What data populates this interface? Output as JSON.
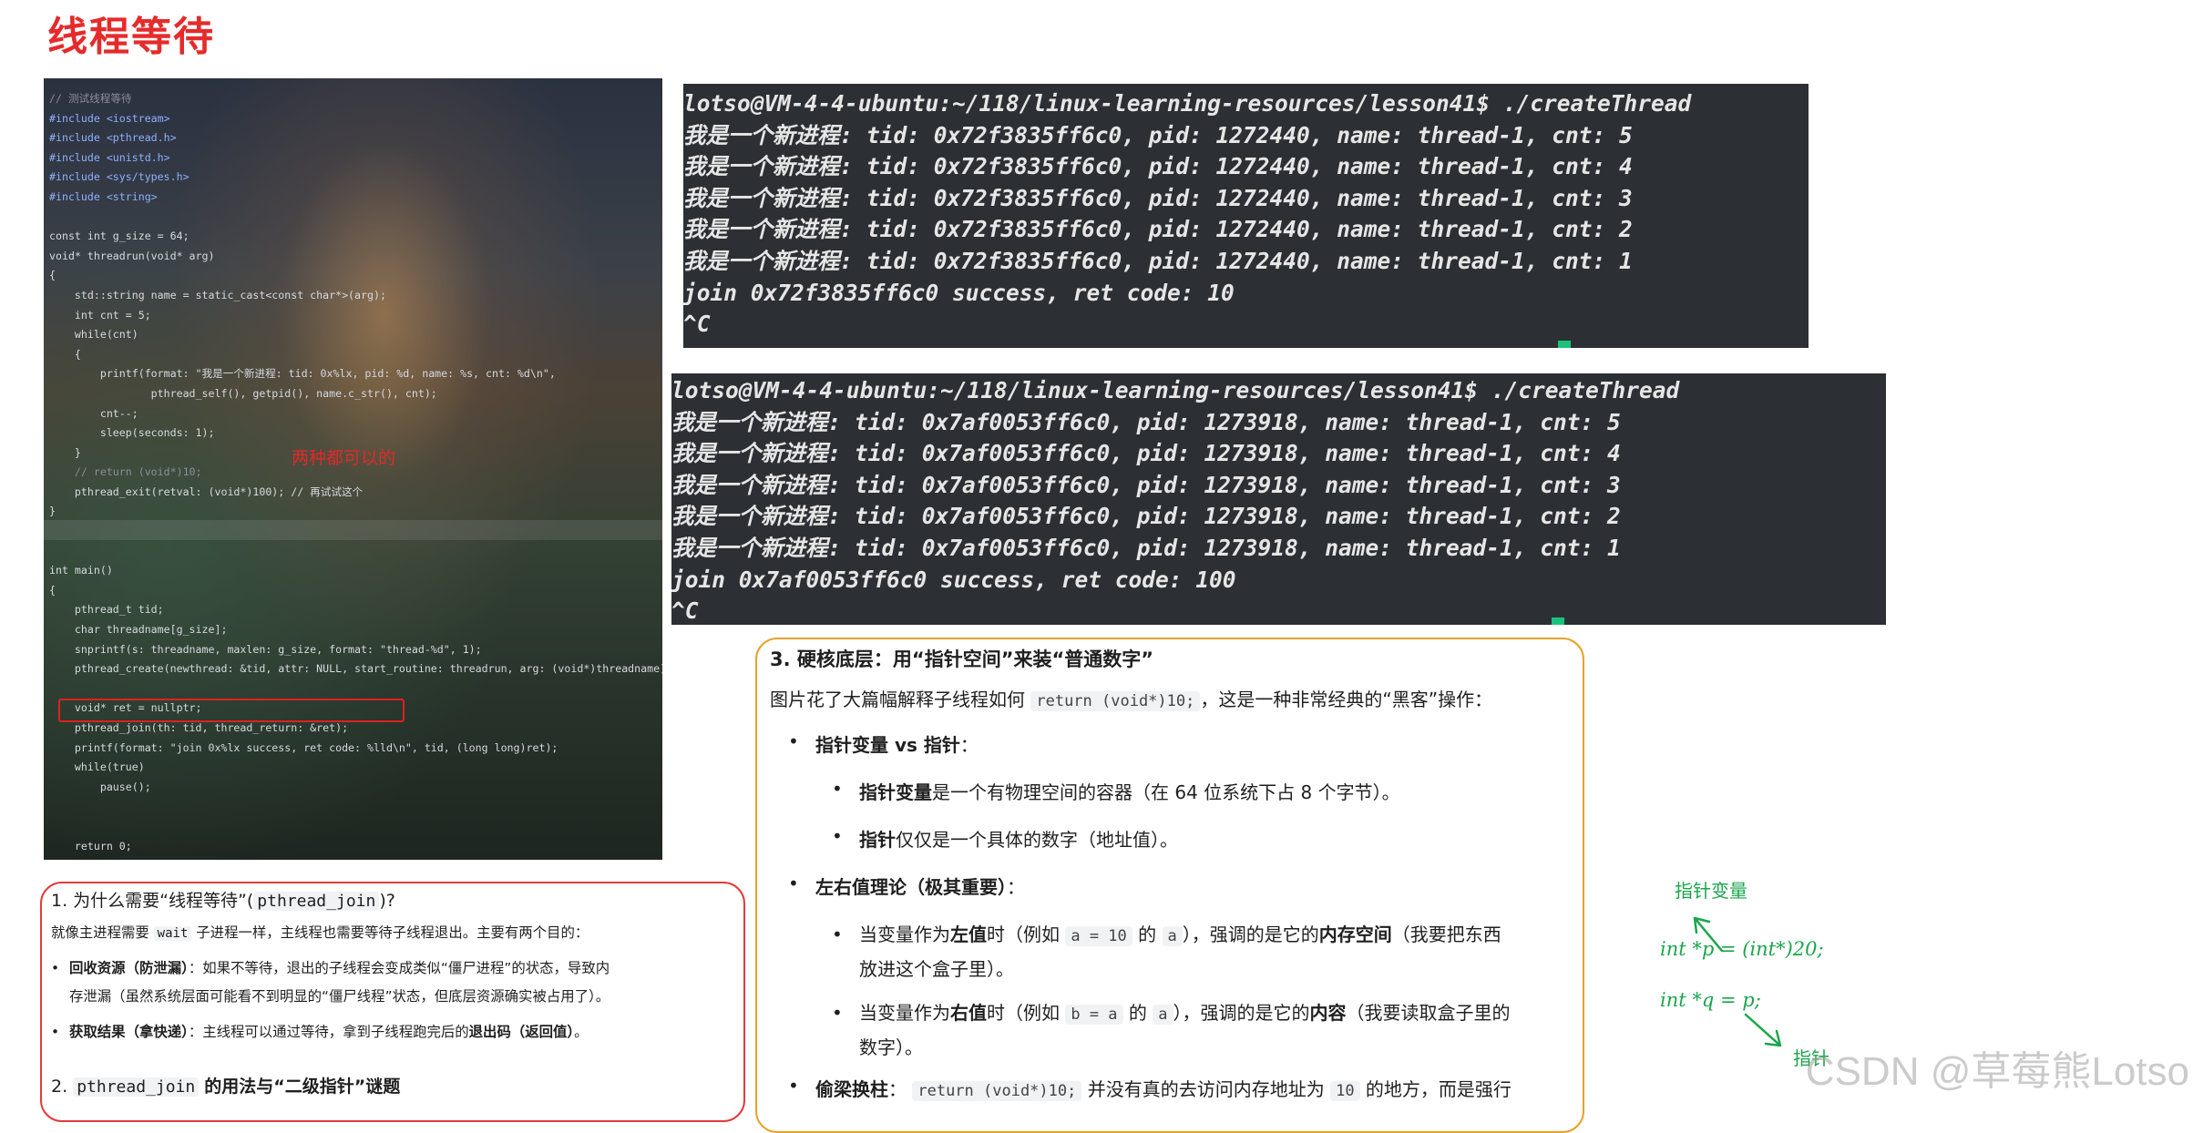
{
  "title": "线程等待",
  "code": {
    "lines": [
      "// 测试线程等待",
      "#include <iostream>",
      "#include <pthread.h>",
      "#include <unistd.h>",
      "#include <sys/types.h>",
      "#include <string>",
      "",
      "const int g_size = 64;",
      "void* threadrun(void* arg)",
      "{",
      "    std::string name = static_cast<const char*>(arg);",
      "    int cnt = 5;",
      "    while(cnt)",
      "    {",
      "        printf(format: \"我是一个新进程: tid: 0x%lx, pid: %d, name: %s, cnt: %d\\n\",",
      "                pthread_self(), getpid(), name.c_str(), cnt);",
      "        cnt--;",
      "        sleep(seconds: 1);",
      "    }",
      "    // return (void*)10;",
      "    pthread_exit(retval: (void*)100); // 再试试这个",
      "}",
      "",
      "",
      "int main()",
      "{",
      "    pthread_t tid;",
      "    char threadname[g_size];",
      "    snprintf(s: threadname, maxlen: g_size, format: \"thread-%d\", 1);",
      "    pthread_create(newthread: &tid, attr: NULL, start_routine: threadrun, arg: (void*)threadname);",
      "",
      "    void* ret = nullptr;",
      "    pthread_join(th: tid, thread_return: &ret);",
      "    printf(format: \"join 0x%lx success, ret code: %lld\\n\", tid, (long long)ret);",
      "    while(true)",
      "        pause();",
      "",
      "",
      "    return 0;",
      "}"
    ],
    "annotation": "两种都可以的"
  },
  "terminal1": {
    "lines": [
      "lotso@VM-4-4-ubuntu:~/118/linux-learning-resources/lesson41$ ./createThread",
      "我是一个新进程: tid: 0x72f3835ff6c0, pid: 1272440, name: thread-1, cnt: 5",
      "我是一个新进程: tid: 0x72f3835ff6c0, pid: 1272440, name: thread-1, cnt: 4",
      "我是一个新进程: tid: 0x72f3835ff6c0, pid: 1272440, name: thread-1, cnt: 3",
      "我是一个新进程: tid: 0x72f3835ff6c0, pid: 1272440, name: thread-1, cnt: 2",
      "我是一个新进程: tid: 0x72f3835ff6c0, pid: 1272440, name: thread-1, cnt: 1",
      "join 0x72f3835ff6c0 success, ret code: 10",
      "^C"
    ]
  },
  "terminal2": {
    "lines": [
      "lotso@VM-4-4-ubuntu:~/118/linux-learning-resources/lesson41$ ./createThread",
      "我是一个新进程: tid: 0x7af0053ff6c0, pid: 1273918, name: thread-1, cnt: 5",
      "我是一个新进程: tid: 0x7af0053ff6c0, pid: 1273918, name: thread-1, cnt: 4",
      "我是一个新进程: tid: 0x7af0053ff6c0, pid: 1273918, name: thread-1, cnt: 3",
      "我是一个新进程: tid: 0x7af0053ff6c0, pid: 1273918, name: thread-1, cnt: 2",
      "我是一个新进程: tid: 0x7af0053ff6c0, pid: 1273918, name: thread-1, cnt: 1",
      "join 0x7af0053ff6c0 success, ret code: 100",
      "^C"
    ]
  },
  "card1": {
    "heading_prefix": "1. 为什么需要“线程等待”(",
    "heading_code": "pthread_join",
    "heading_suffix": ")?",
    "intro_prefix": "就像主进程需要",
    "intro_code": "wait",
    "intro_suffix": "子进程一样，主线程也需要等待子线程退出。主要有两个目的：",
    "bullet1_bold": "回收资源（防泄漏）",
    "bullet1_text": "：如果不等待，退出的子线程会变成类似“僵尸进程”的状态，导致内",
    "bullet1_text2": "存泄漏（虽然系统层面可能看不到明显的“僵尸线程”状态，但底层资源确实被占用了）。",
    "bullet2_bold": "获取结果（拿快递）",
    "bullet2_text": "：主线程可以通过等待，拿到子线程跑完后的",
    "bullet2_bold2": "退出码（返回值）",
    "bullet2_end": "。",
    "heading2_prefix": "2.",
    "heading2_code": "pthread_join",
    "heading2_suffix": "的用法与“二级指针”谜题"
  },
  "card2": {
    "heading": "3. 硬核底层：用“指针空间”来装“普通数字”",
    "intro_prefix": "图片花了大篇幅解释子线程如何",
    "intro_code": "return (void*)10;",
    "intro_suffix": "，这是一种非常经典的“黑客”操作：",
    "b1": "指针变量 vs 指针",
    "b1_end": "：",
    "b1a_bold": "指针变量",
    "b1a_text": "是一个有物理空间的容器（在 64 位系统下占 8 个字节）。",
    "b1b_bold": "指针",
    "b1b_text": "仅仅是一个具体的数字（地址值）。",
    "b2": "左右值理论（极其重要）",
    "b2_end": "：",
    "b2a_1": "当变量作为",
    "b2a_bold": "左值",
    "b2a_2": "时（例如",
    "b2a_code1": "a = 10",
    "b2a_3": "的",
    "b2a_code2": "a",
    "b2a_4": "），强调的是它的",
    "b2a_bold2": "内存空间",
    "b2a_5": "（我要把东西",
    "b2a_6": "放进这个盒子里）。",
    "b2b_1": "当变量作为",
    "b2b_bold": "右值",
    "b2b_2": "时（例如",
    "b2b_code1": "b = a",
    "b2b_3": "的",
    "b2b_code2": "a",
    "b2b_4": "），强调的是它的",
    "b2b_bold2": "内容",
    "b2b_5": "（我要读取盒子里的",
    "b2b_6": "数字）。",
    "b3": "偷梁换柱",
    "b3_1": "：",
    "b3_code": "return (void*)10;",
    "b3_2": "并没有真的去访问内存地址为",
    "b3_code2": "10",
    "b3_3": "的地方，而是强行"
  },
  "notes": {
    "label_top": "指针变量",
    "line1": "int *p = (int*)20;",
    "line2": "int *q = p;",
    "label_bottom": "指针"
  },
  "watermark": "CSDN @草莓熊Lotso"
}
